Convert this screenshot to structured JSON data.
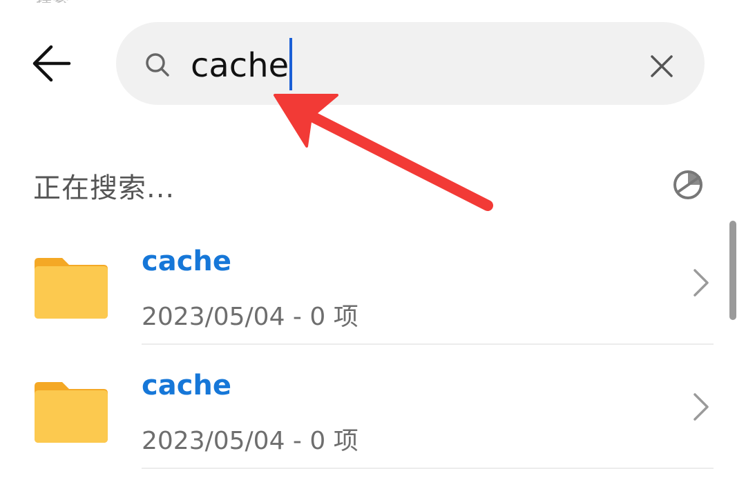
{
  "header": {
    "back_icon": "back-arrow-icon",
    "clipped_title": "搜索"
  },
  "search": {
    "icon": "search-icon",
    "value": "cache",
    "clear_icon": "close-icon"
  },
  "status": {
    "label": "正在搜索...",
    "icon": "loading-spinner-icon"
  },
  "results": [
    {
      "name": "cache",
      "meta": "2023/05/04 - 0 项",
      "icon": "folder-icon"
    },
    {
      "name": "cache",
      "meta": "2023/05/04 - 0 项",
      "icon": "folder-icon"
    }
  ],
  "colors": {
    "accent": "#1677d8",
    "folder": "#f7c44c",
    "annotation": "#f23a36",
    "caret": "#1a5fd6"
  }
}
